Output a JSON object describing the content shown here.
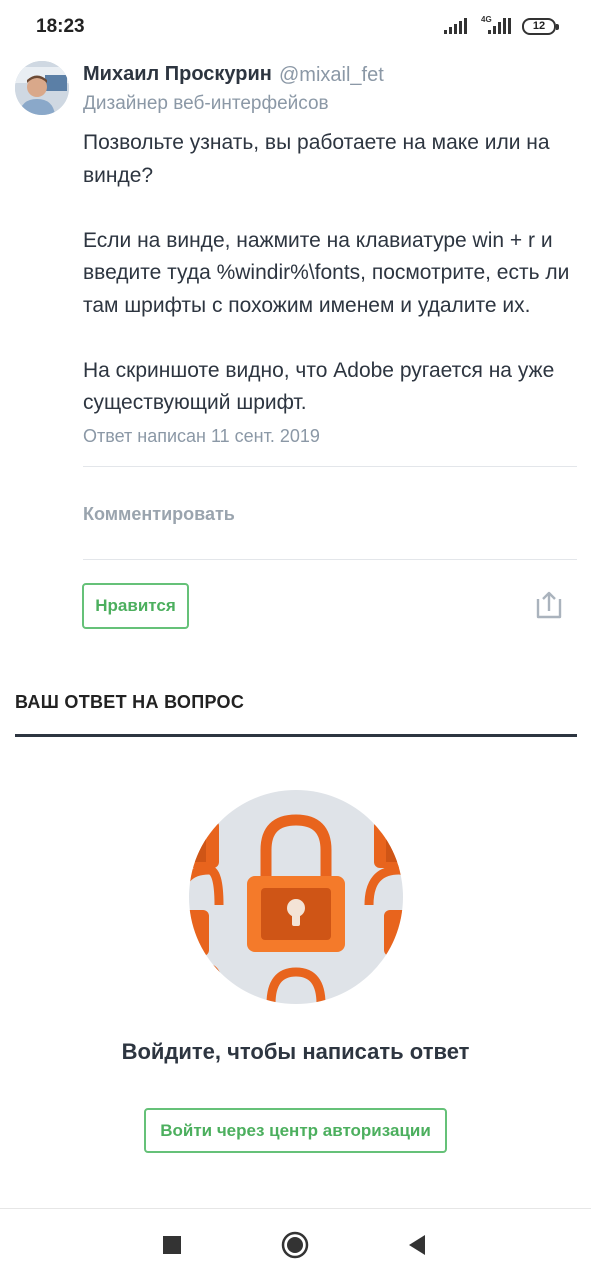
{
  "status_bar": {
    "time": "18:23",
    "network_label": "4G",
    "battery": "12"
  },
  "answer": {
    "author_name": "Михаил Проскурин",
    "author_handle": "@mixail_fet",
    "author_role": "Дизайнер веб-интерфейсов",
    "paragraphs": [
      "Позвольте узнать, вы работаете на маке или на винде?",
      "Если на винде, нажмите на клавиатуре win + r и введите туда %windir%\\fonts, посмотрите, есть ли там шрифты с похожим именем и удалите их.",
      "На скриншоте видно, что Adobe ругается на уже существующий шрифт."
    ],
    "date": "Ответ написан 11 сент. 2019",
    "comment_label": "Комментировать",
    "like_label": "Нравится"
  },
  "your_answer": {
    "section_title": "ВАШ ОТВЕТ НА ВОПРОС",
    "login_prompt": "Войдите, чтобы написать ответ",
    "login_button": "Войти через центр авторизации"
  },
  "colors": {
    "accent_green": "#65c178",
    "lock_orange": "#e8641d",
    "text_dark": "#2d3540",
    "text_muted": "#8b98a6"
  }
}
